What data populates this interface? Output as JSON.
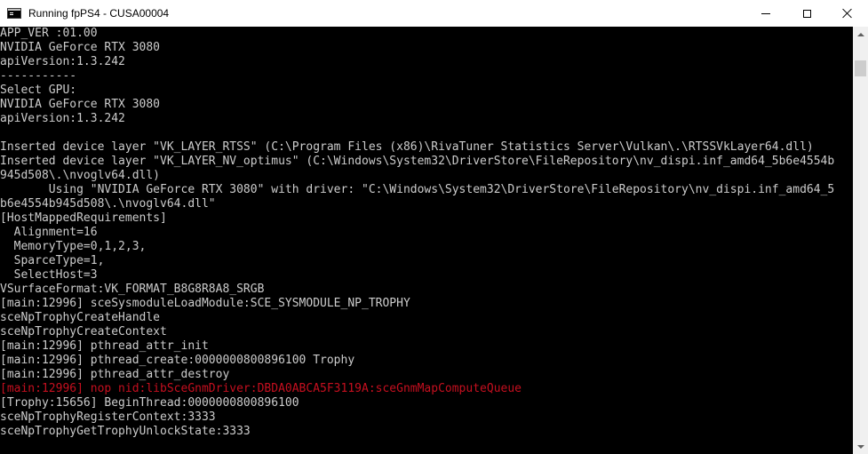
{
  "window": {
    "title": "Running fpPS4 - CUSA00004"
  },
  "icons": {
    "app": "console-app-icon",
    "minimize": "minimize-icon",
    "maximize": "maximize-icon",
    "close": "close-icon"
  },
  "colors": {
    "console_bg": "#000000",
    "console_text": "#cccccc",
    "error_text": "#c50f1f"
  },
  "console": {
    "lines": [
      {
        "text": "APP_VER :01.00",
        "error": false
      },
      {
        "text": "NVIDIA GeForce RTX 3080",
        "error": false
      },
      {
        "text": "apiVersion:1.3.242",
        "error": false
      },
      {
        "text": "-----------",
        "error": false
      },
      {
        "text": "Select GPU:",
        "error": false
      },
      {
        "text": "NVIDIA GeForce RTX 3080",
        "error": false
      },
      {
        "text": "apiVersion:1.3.242",
        "error": false
      },
      {
        "text": "",
        "error": false
      },
      {
        "text": "Inserted device layer \"VK_LAYER_RTSS\" (C:\\Program Files (x86)\\RivaTuner Statistics Server\\Vulkan\\.\\RTSSVkLayer64.dll)",
        "error": false
      },
      {
        "text": "Inserted device layer \"VK_LAYER_NV_optimus\" (C:\\Windows\\System32\\DriverStore\\FileRepository\\nv_dispi.inf_amd64_5b6e4554b",
        "error": false
      },
      {
        "text": "945d508\\.\\nvoglv64.dll)",
        "error": false
      },
      {
        "text": "       Using \"NVIDIA GeForce RTX 3080\" with driver: \"C:\\Windows\\System32\\DriverStore\\FileRepository\\nv_dispi.inf_amd64_5",
        "error": false
      },
      {
        "text": "b6e4554b945d508\\.\\nvoglv64.dll\"",
        "error": false
      },
      {
        "text": "[HostMappedRequirements]",
        "error": false
      },
      {
        "text": "  Alignment=16",
        "error": false
      },
      {
        "text": "  MemoryType=0,1,2,3,",
        "error": false
      },
      {
        "text": "  SparceType=1,",
        "error": false
      },
      {
        "text": "  SelectHost=3",
        "error": false
      },
      {
        "text": "VSurfaceFormat:VK_FORMAT_B8G8R8A8_SRGB",
        "error": false
      },
      {
        "text": "[main:12996] sceSysmoduleLoadModule:SCE_SYSMODULE_NP_TROPHY",
        "error": false
      },
      {
        "text": "sceNpTrophyCreateHandle",
        "error": false
      },
      {
        "text": "sceNpTrophyCreateContext",
        "error": false
      },
      {
        "text": "[main:12996] pthread_attr_init",
        "error": false
      },
      {
        "text": "[main:12996] pthread_create:0000000800896100 Trophy",
        "error": false
      },
      {
        "text": "[main:12996] pthread_attr_destroy",
        "error": false
      },
      {
        "text": "[main:12996] nop nid:libSceGnmDriver:DBDA0ABCA5F3119A:sceGnmMapComputeQueue",
        "error": true
      },
      {
        "text": "[Trophy:15656] BeginThread:0000000800896100",
        "error": false
      },
      {
        "text": "sceNpTrophyRegisterContext:3333",
        "error": false
      },
      {
        "text": "sceNpTrophyGetTrophyUnlockState:3333",
        "error": false
      }
    ]
  }
}
